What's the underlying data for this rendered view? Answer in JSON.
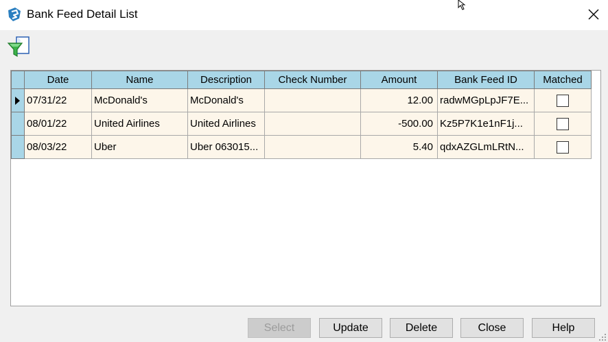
{
  "window": {
    "title": "Bank Feed Detail List",
    "close_glyph": "✕"
  },
  "toolbar": {
    "filter_icon": "filter-document-icon"
  },
  "grid": {
    "columns": [
      "Date",
      "Name",
      "Description",
      "Check Number",
      "Amount",
      "Bank Feed ID",
      "Matched"
    ],
    "rows": [
      {
        "date": "07/31/22",
        "name": "McDonald's",
        "description": "McDonald's",
        "check_number": "",
        "amount": "12.00",
        "bank_feed_id": "radwMGpLpJF7E...",
        "matched": false,
        "current": true
      },
      {
        "date": "08/01/22",
        "name": "United Airlines",
        "description": "United Airlines",
        "check_number": "",
        "amount": "-500.00",
        "bank_feed_id": "Kz5P7K1e1nF1j...",
        "matched": false,
        "current": false
      },
      {
        "date": "08/03/22",
        "name": "Uber",
        "description": "Uber 063015...",
        "check_number": "",
        "amount": "5.40",
        "bank_feed_id": "qdxAZGLmLRtN...",
        "matched": false,
        "current": false
      }
    ]
  },
  "buttons": {
    "select": "Select",
    "update": "Update",
    "delete": "Delete",
    "close": "Close",
    "help": "Help"
  },
  "colors": {
    "header_bg": "#a9d6e7",
    "row_bg": "#fdf6ea",
    "dialog_bg": "#f0f0f0"
  }
}
